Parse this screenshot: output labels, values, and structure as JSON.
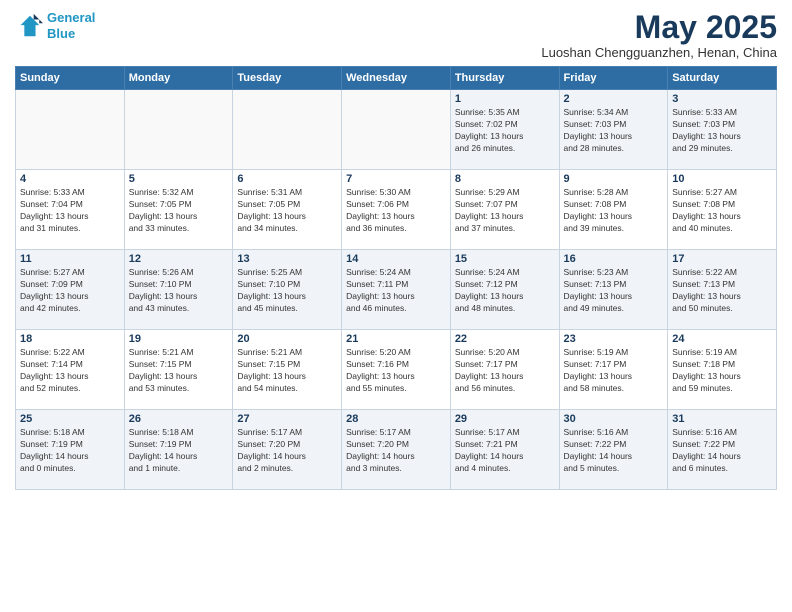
{
  "header": {
    "logo_line1": "General",
    "logo_line2": "Blue",
    "month_title": "May 2025",
    "location": "Luoshan Chengguanzhen, Henan, China"
  },
  "weekdays": [
    "Sunday",
    "Monday",
    "Tuesday",
    "Wednesday",
    "Thursday",
    "Friday",
    "Saturday"
  ],
  "weeks": [
    [
      {
        "num": "",
        "info": ""
      },
      {
        "num": "",
        "info": ""
      },
      {
        "num": "",
        "info": ""
      },
      {
        "num": "",
        "info": ""
      },
      {
        "num": "1",
        "info": "Sunrise: 5:35 AM\nSunset: 7:02 PM\nDaylight: 13 hours\nand 26 minutes."
      },
      {
        "num": "2",
        "info": "Sunrise: 5:34 AM\nSunset: 7:03 PM\nDaylight: 13 hours\nand 28 minutes."
      },
      {
        "num": "3",
        "info": "Sunrise: 5:33 AM\nSunset: 7:03 PM\nDaylight: 13 hours\nand 29 minutes."
      }
    ],
    [
      {
        "num": "4",
        "info": "Sunrise: 5:33 AM\nSunset: 7:04 PM\nDaylight: 13 hours\nand 31 minutes."
      },
      {
        "num": "5",
        "info": "Sunrise: 5:32 AM\nSunset: 7:05 PM\nDaylight: 13 hours\nand 33 minutes."
      },
      {
        "num": "6",
        "info": "Sunrise: 5:31 AM\nSunset: 7:05 PM\nDaylight: 13 hours\nand 34 minutes."
      },
      {
        "num": "7",
        "info": "Sunrise: 5:30 AM\nSunset: 7:06 PM\nDaylight: 13 hours\nand 36 minutes."
      },
      {
        "num": "8",
        "info": "Sunrise: 5:29 AM\nSunset: 7:07 PM\nDaylight: 13 hours\nand 37 minutes."
      },
      {
        "num": "9",
        "info": "Sunrise: 5:28 AM\nSunset: 7:08 PM\nDaylight: 13 hours\nand 39 minutes."
      },
      {
        "num": "10",
        "info": "Sunrise: 5:27 AM\nSunset: 7:08 PM\nDaylight: 13 hours\nand 40 minutes."
      }
    ],
    [
      {
        "num": "11",
        "info": "Sunrise: 5:27 AM\nSunset: 7:09 PM\nDaylight: 13 hours\nand 42 minutes."
      },
      {
        "num": "12",
        "info": "Sunrise: 5:26 AM\nSunset: 7:10 PM\nDaylight: 13 hours\nand 43 minutes."
      },
      {
        "num": "13",
        "info": "Sunrise: 5:25 AM\nSunset: 7:10 PM\nDaylight: 13 hours\nand 45 minutes."
      },
      {
        "num": "14",
        "info": "Sunrise: 5:24 AM\nSunset: 7:11 PM\nDaylight: 13 hours\nand 46 minutes."
      },
      {
        "num": "15",
        "info": "Sunrise: 5:24 AM\nSunset: 7:12 PM\nDaylight: 13 hours\nand 48 minutes."
      },
      {
        "num": "16",
        "info": "Sunrise: 5:23 AM\nSunset: 7:13 PM\nDaylight: 13 hours\nand 49 minutes."
      },
      {
        "num": "17",
        "info": "Sunrise: 5:22 AM\nSunset: 7:13 PM\nDaylight: 13 hours\nand 50 minutes."
      }
    ],
    [
      {
        "num": "18",
        "info": "Sunrise: 5:22 AM\nSunset: 7:14 PM\nDaylight: 13 hours\nand 52 minutes."
      },
      {
        "num": "19",
        "info": "Sunrise: 5:21 AM\nSunset: 7:15 PM\nDaylight: 13 hours\nand 53 minutes."
      },
      {
        "num": "20",
        "info": "Sunrise: 5:21 AM\nSunset: 7:15 PM\nDaylight: 13 hours\nand 54 minutes."
      },
      {
        "num": "21",
        "info": "Sunrise: 5:20 AM\nSunset: 7:16 PM\nDaylight: 13 hours\nand 55 minutes."
      },
      {
        "num": "22",
        "info": "Sunrise: 5:20 AM\nSunset: 7:17 PM\nDaylight: 13 hours\nand 56 minutes."
      },
      {
        "num": "23",
        "info": "Sunrise: 5:19 AM\nSunset: 7:17 PM\nDaylight: 13 hours\nand 58 minutes."
      },
      {
        "num": "24",
        "info": "Sunrise: 5:19 AM\nSunset: 7:18 PM\nDaylight: 13 hours\nand 59 minutes."
      }
    ],
    [
      {
        "num": "25",
        "info": "Sunrise: 5:18 AM\nSunset: 7:19 PM\nDaylight: 14 hours\nand 0 minutes."
      },
      {
        "num": "26",
        "info": "Sunrise: 5:18 AM\nSunset: 7:19 PM\nDaylight: 14 hours\nand 1 minute."
      },
      {
        "num": "27",
        "info": "Sunrise: 5:17 AM\nSunset: 7:20 PM\nDaylight: 14 hours\nand 2 minutes."
      },
      {
        "num": "28",
        "info": "Sunrise: 5:17 AM\nSunset: 7:20 PM\nDaylight: 14 hours\nand 3 minutes."
      },
      {
        "num": "29",
        "info": "Sunrise: 5:17 AM\nSunset: 7:21 PM\nDaylight: 14 hours\nand 4 minutes."
      },
      {
        "num": "30",
        "info": "Sunrise: 5:16 AM\nSunset: 7:22 PM\nDaylight: 14 hours\nand 5 minutes."
      },
      {
        "num": "31",
        "info": "Sunrise: 5:16 AM\nSunset: 7:22 PM\nDaylight: 14 hours\nand 6 minutes."
      }
    ]
  ]
}
